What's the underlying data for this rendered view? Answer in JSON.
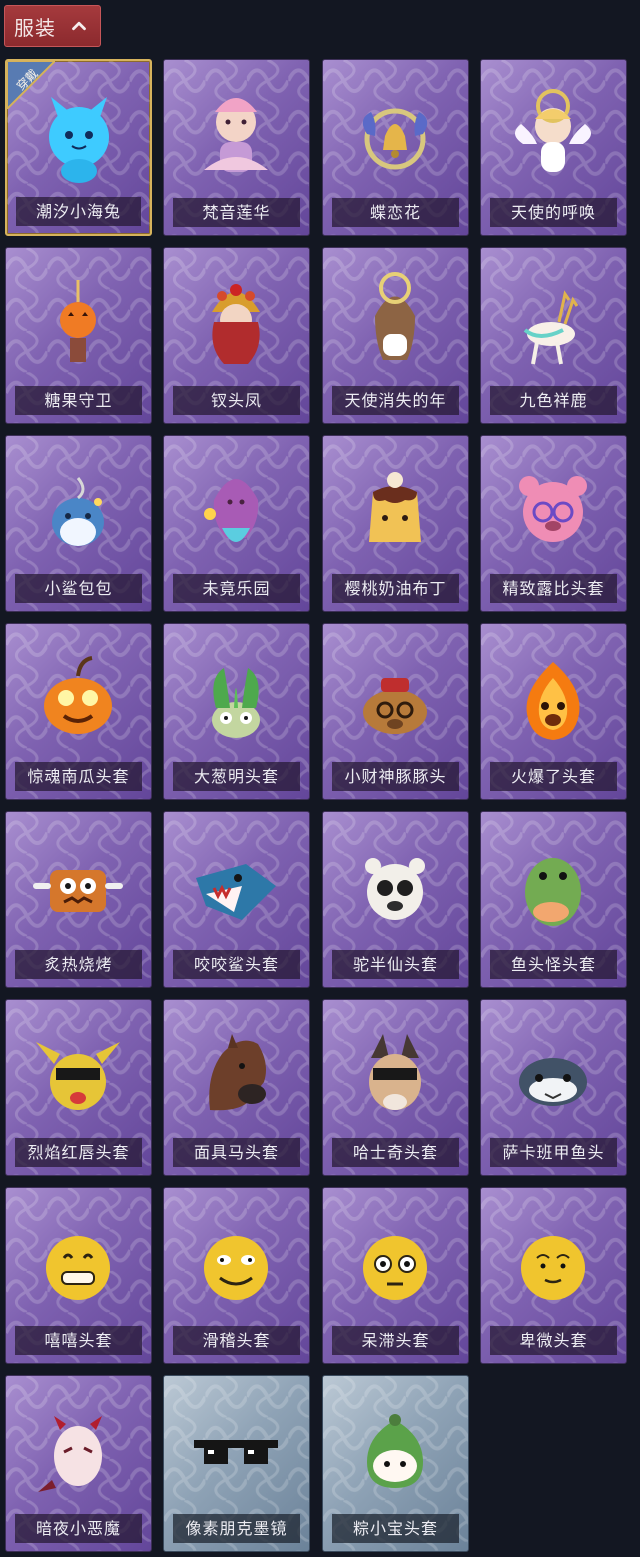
{
  "header": {
    "category_label": "服装",
    "collapse_icon": "chevron-up-icon"
  },
  "equipped_badge": "穿戴",
  "colors": {
    "background": "#131722",
    "purple_card": "#7f62b1",
    "blue_card": "#8fa3b6",
    "selected_border": "#d6b35d",
    "category_button": "#9c3236"
  },
  "items": [
    {
      "name": "潮汐小海兔",
      "art": "blue-bunny-icon",
      "variant": "purple",
      "equipped": true
    },
    {
      "name": "梵音莲华",
      "art": "lotus-character-icon",
      "variant": "purple"
    },
    {
      "name": "蝶恋花",
      "art": "butterfly-bell-icon",
      "variant": "purple"
    },
    {
      "name": "天使的呼唤",
      "art": "angel-icon",
      "variant": "purple"
    },
    {
      "name": "糖果守卫",
      "art": "pumpkin-guard-icon",
      "variant": "purple"
    },
    {
      "name": "钗头凤",
      "art": "phoenix-crown-icon",
      "variant": "purple"
    },
    {
      "name": "天使消失的年",
      "art": "angel-girl-icon",
      "variant": "purple"
    },
    {
      "name": "九色祥鹿",
      "art": "deer-icon",
      "variant": "purple"
    },
    {
      "name": "小鲨包包",
      "art": "shark-bag-icon",
      "variant": "purple"
    },
    {
      "name": "未竟乐园",
      "art": "fairy-girl-icon",
      "variant": "purple"
    },
    {
      "name": "樱桃奶油布丁",
      "art": "pudding-icon",
      "variant": "purple"
    },
    {
      "name": "精致露比头套",
      "art": "pink-bear-head-icon",
      "variant": "purple"
    },
    {
      "name": "惊魂南瓜头套",
      "art": "pumpkin-head-icon",
      "variant": "purple"
    },
    {
      "name": "大葱明头套",
      "art": "green-onion-head-icon",
      "variant": "purple"
    },
    {
      "name": "小财神豚豚头",
      "art": "capybara-head-icon",
      "variant": "purple"
    },
    {
      "name": "火爆了头套",
      "art": "fire-head-icon",
      "variant": "purple"
    },
    {
      "name": "炙热烧烤",
      "art": "barbecue-head-icon",
      "variant": "purple"
    },
    {
      "name": "咬咬鲨头套",
      "art": "shark-head-icon",
      "variant": "purple"
    },
    {
      "name": "驼半仙头套",
      "art": "bear-sunglasses-icon",
      "variant": "purple"
    },
    {
      "name": "鱼头怪头套",
      "art": "fish-head-icon",
      "variant": "purple"
    },
    {
      "name": "烈焰红唇头套",
      "art": "pikachu-head-icon",
      "variant": "purple"
    },
    {
      "name": "面具马头套",
      "art": "horse-head-icon",
      "variant": "purple"
    },
    {
      "name": "哈士奇头套",
      "art": "husky-head-icon",
      "variant": "purple"
    },
    {
      "name": "萨卡班甲鱼头",
      "art": "fish-mask-icon",
      "variant": "purple"
    },
    {
      "name": "嘻嘻头套",
      "art": "grinning-face-icon",
      "variant": "purple"
    },
    {
      "name": "滑稽头套",
      "art": "funny-face-icon",
      "variant": "purple"
    },
    {
      "name": "呆滞头套",
      "art": "stunned-face-icon",
      "variant": "purple"
    },
    {
      "name": "卑微头套",
      "art": "humble-face-icon",
      "variant": "purple"
    },
    {
      "name": "暗夜小恶魔",
      "art": "little-devil-icon",
      "variant": "purple"
    },
    {
      "name": "像素朋克墨镜",
      "art": "pixel-sunglasses-icon",
      "variant": "blue"
    },
    {
      "name": "粽小宝头套",
      "art": "rice-dumpling-head-icon",
      "variant": "blue"
    }
  ]
}
